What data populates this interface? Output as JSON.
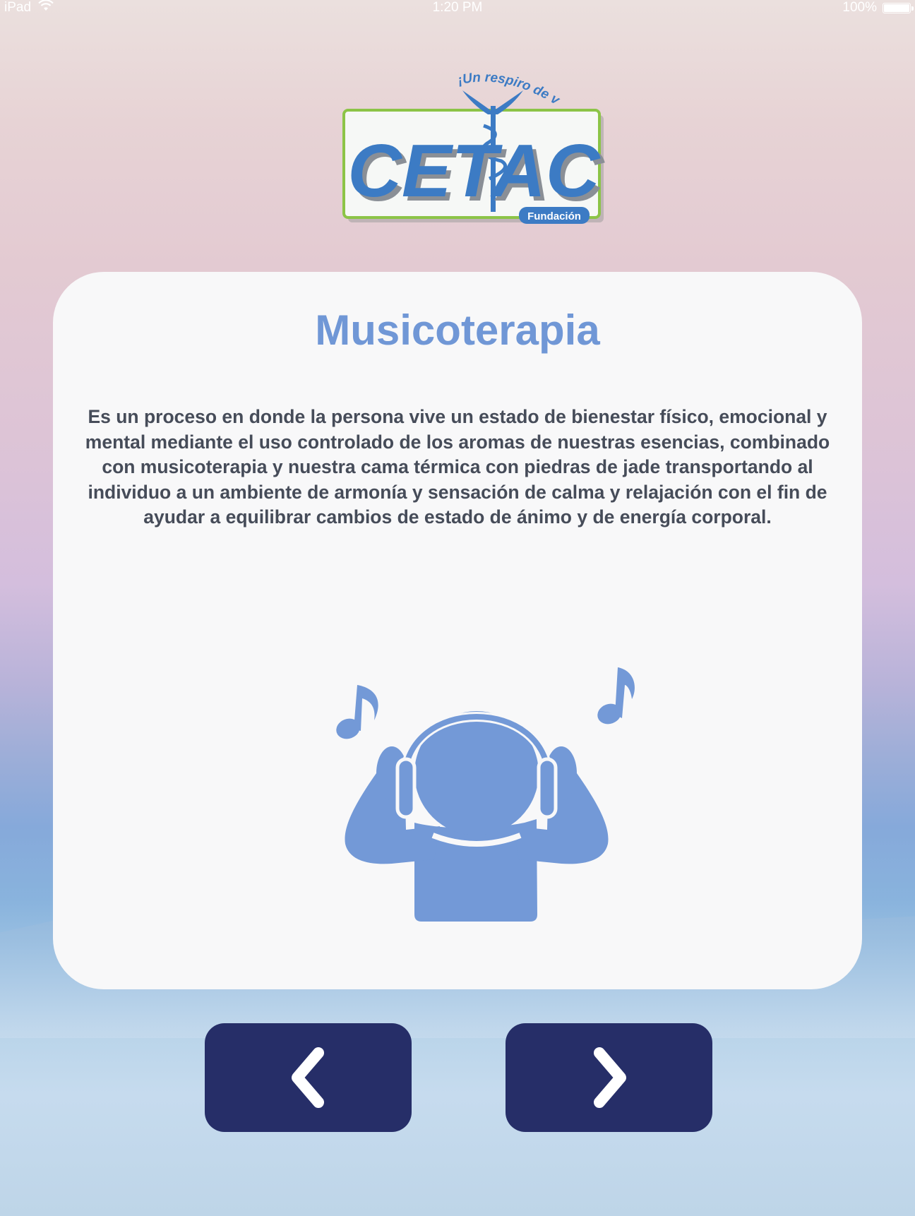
{
  "status_bar": {
    "device": "iPad",
    "time": "1:20 PM",
    "battery": "100%"
  },
  "logo": {
    "brand": "CETAC",
    "tagline": "¡Un respiro de vida!",
    "subtitle": "Fundación"
  },
  "content": {
    "title": "Musicoterapia",
    "description": "Es un proceso en donde la persona vive un estado de bienestar físico, emocional y mental mediante el uso controlado de los aromas de nuestras esencias, combinado con musicoterapia y nuestra cama térmica con piedras de jade transportando al individuo a un ambiente de armonía y sensación de calma y relajación con el fin de ayudar a equilibrar cambios de estado de ánimo y de energía corporal.",
    "illustration_icon": "person-with-headphones-icon"
  },
  "navigation": {
    "prev_icon": "chevron-left-icon",
    "next_icon": "chevron-right-icon"
  },
  "colors": {
    "accent": "#7097d6",
    "button": "#262e68",
    "card": "#f8f8f9",
    "text": "#464c59"
  }
}
